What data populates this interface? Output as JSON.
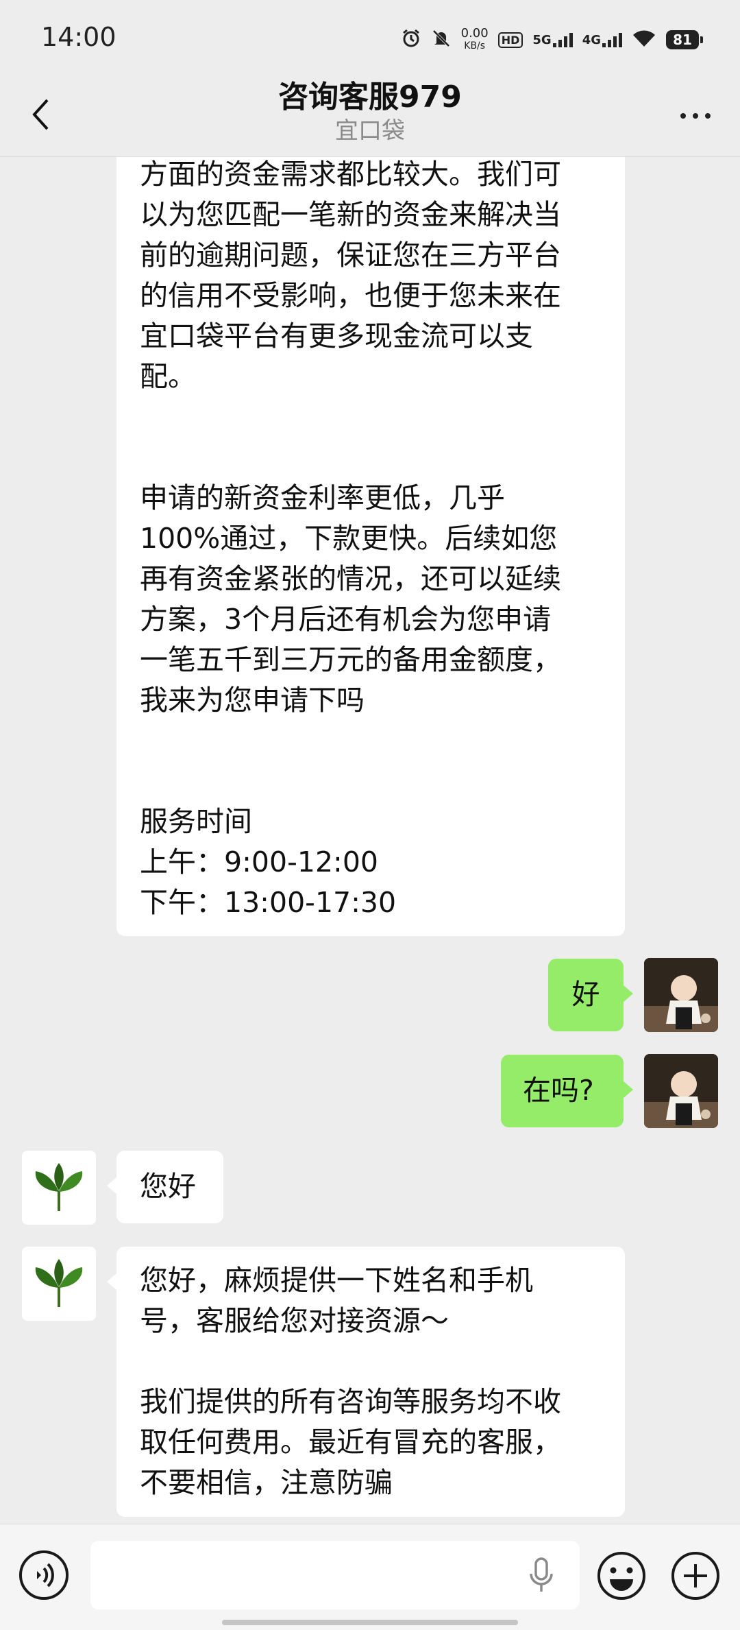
{
  "status_bar": {
    "time": "14:00",
    "net_speed_value": "0.00",
    "net_speed_unit": "KB/s",
    "hd_label": "HD",
    "sim1_label": "5G",
    "sim2_label": "4G",
    "battery": "81"
  },
  "header": {
    "title": "咨询客服979",
    "subtitle": "宜口袋"
  },
  "messages": [
    {
      "side": "left",
      "paragraphs": [
        [
          "方面的资金需求都比较大。我们可",
          "以为您匹配一笔新的资金来解决当",
          "前的逾期问题，保证您在三方平台",
          "的信用不受影响，也便于您未来在",
          "宜口袋平台有更多现金流可以支",
          "配。"
        ],
        [
          "申请的新资金利率更低，几乎",
          "100%通过，下款更快。后续如您",
          "再有资金紧张的情况，还可以延续",
          "方案，3个月后还有机会为您申请",
          "一笔五千到三万元的备用金额度，",
          "我来为您申请下吗"
        ],
        [
          "服务时间",
          "上午：9:00-12:00",
          "下午：13:00-17:30"
        ]
      ]
    },
    {
      "side": "right",
      "text": "好"
    },
    {
      "side": "right",
      "text": "在吗?"
    },
    {
      "side": "left",
      "text": "您好"
    },
    {
      "side": "left",
      "paragraphs": [
        [
          "您好，麻烦提供一下姓名和手机",
          "号，客服给您对接资源～"
        ],
        [
          "我们提供的所有咨询等服务均不收",
          "取任何费用。最近有冒充的客服，",
          "不要相信，注意防骗"
        ]
      ]
    }
  ],
  "colors": {
    "background": "#ededed",
    "own_bubble": "#95ec69",
    "other_bubble": "#ffffff"
  },
  "input_bar": {
    "placeholder": ""
  }
}
